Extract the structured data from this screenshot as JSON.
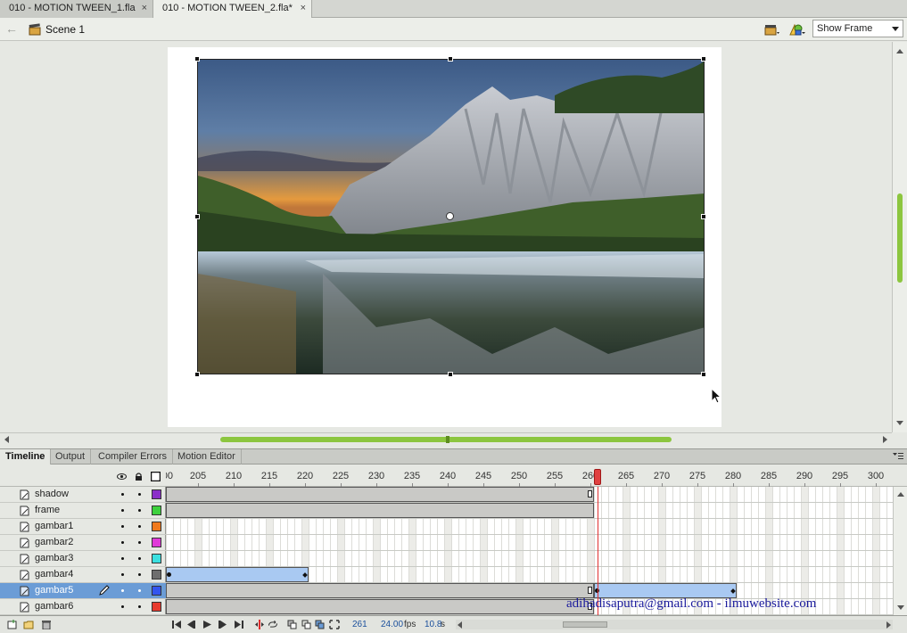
{
  "doc_tabs": [
    {
      "label": "010 - MOTION TWEEN_1.fla",
      "close": "×"
    },
    {
      "label": "010 - MOTION TWEEN_2.fla*",
      "close": "×"
    }
  ],
  "scene": {
    "label": "Scene 1"
  },
  "zoom": {
    "value": "Show Frame"
  },
  "panel_tabs": [
    "Timeline",
    "Output",
    "Compiler Errors",
    "Motion Editor"
  ],
  "ruler": {
    "start_label": "00",
    "labels": [
      "205",
      "210",
      "215",
      "220",
      "225",
      "230",
      "235",
      "240",
      "245",
      "250",
      "255",
      "260",
      "265",
      "270",
      "275",
      "280",
      "285",
      "290",
      "295",
      "300"
    ],
    "playhead_frame": 261
  },
  "layers": [
    {
      "name": "shadow",
      "color": "#8b2fc9",
      "selected": false
    },
    {
      "name": "frame",
      "color": "#3dd13d",
      "selected": false
    },
    {
      "name": "gambar1",
      "color": "#f07a1e",
      "selected": false
    },
    {
      "name": "gambar2",
      "color": "#e03ad8",
      "selected": false
    },
    {
      "name": "gambar3",
      "color": "#3be0e0",
      "selected": false
    },
    {
      "name": "gambar4",
      "color": "#6e6e6e",
      "selected": false
    },
    {
      "name": "gambar5",
      "color": "#3355ee",
      "selected": true
    },
    {
      "name": "gambar6",
      "color": "#e83b2e",
      "selected": false
    }
  ],
  "footer": {
    "current_frame": "261",
    "fps_value": "24.00",
    "fps_unit": "fps",
    "time_value": "10.8",
    "time_unit": "s"
  },
  "watermark": "adihadisaputra@gmail.com - ilmuwebsite.com",
  "icons": {
    "back": "arrow-left-icon",
    "scene": "clapper-icon",
    "edit_scene": "edit-scene-icon",
    "edit_symbol": "edit-symbol-icon",
    "eye": "eye-icon",
    "lock": "lock-icon",
    "outline": "outline-icon"
  },
  "colors": {
    "accent_green": "#8cc63f",
    "selection_blue": "#6b9cd6",
    "tween_blue": "#a9c9f2",
    "playhead_red": "#e03030",
    "watermark_blue": "#1a1a9c"
  }
}
